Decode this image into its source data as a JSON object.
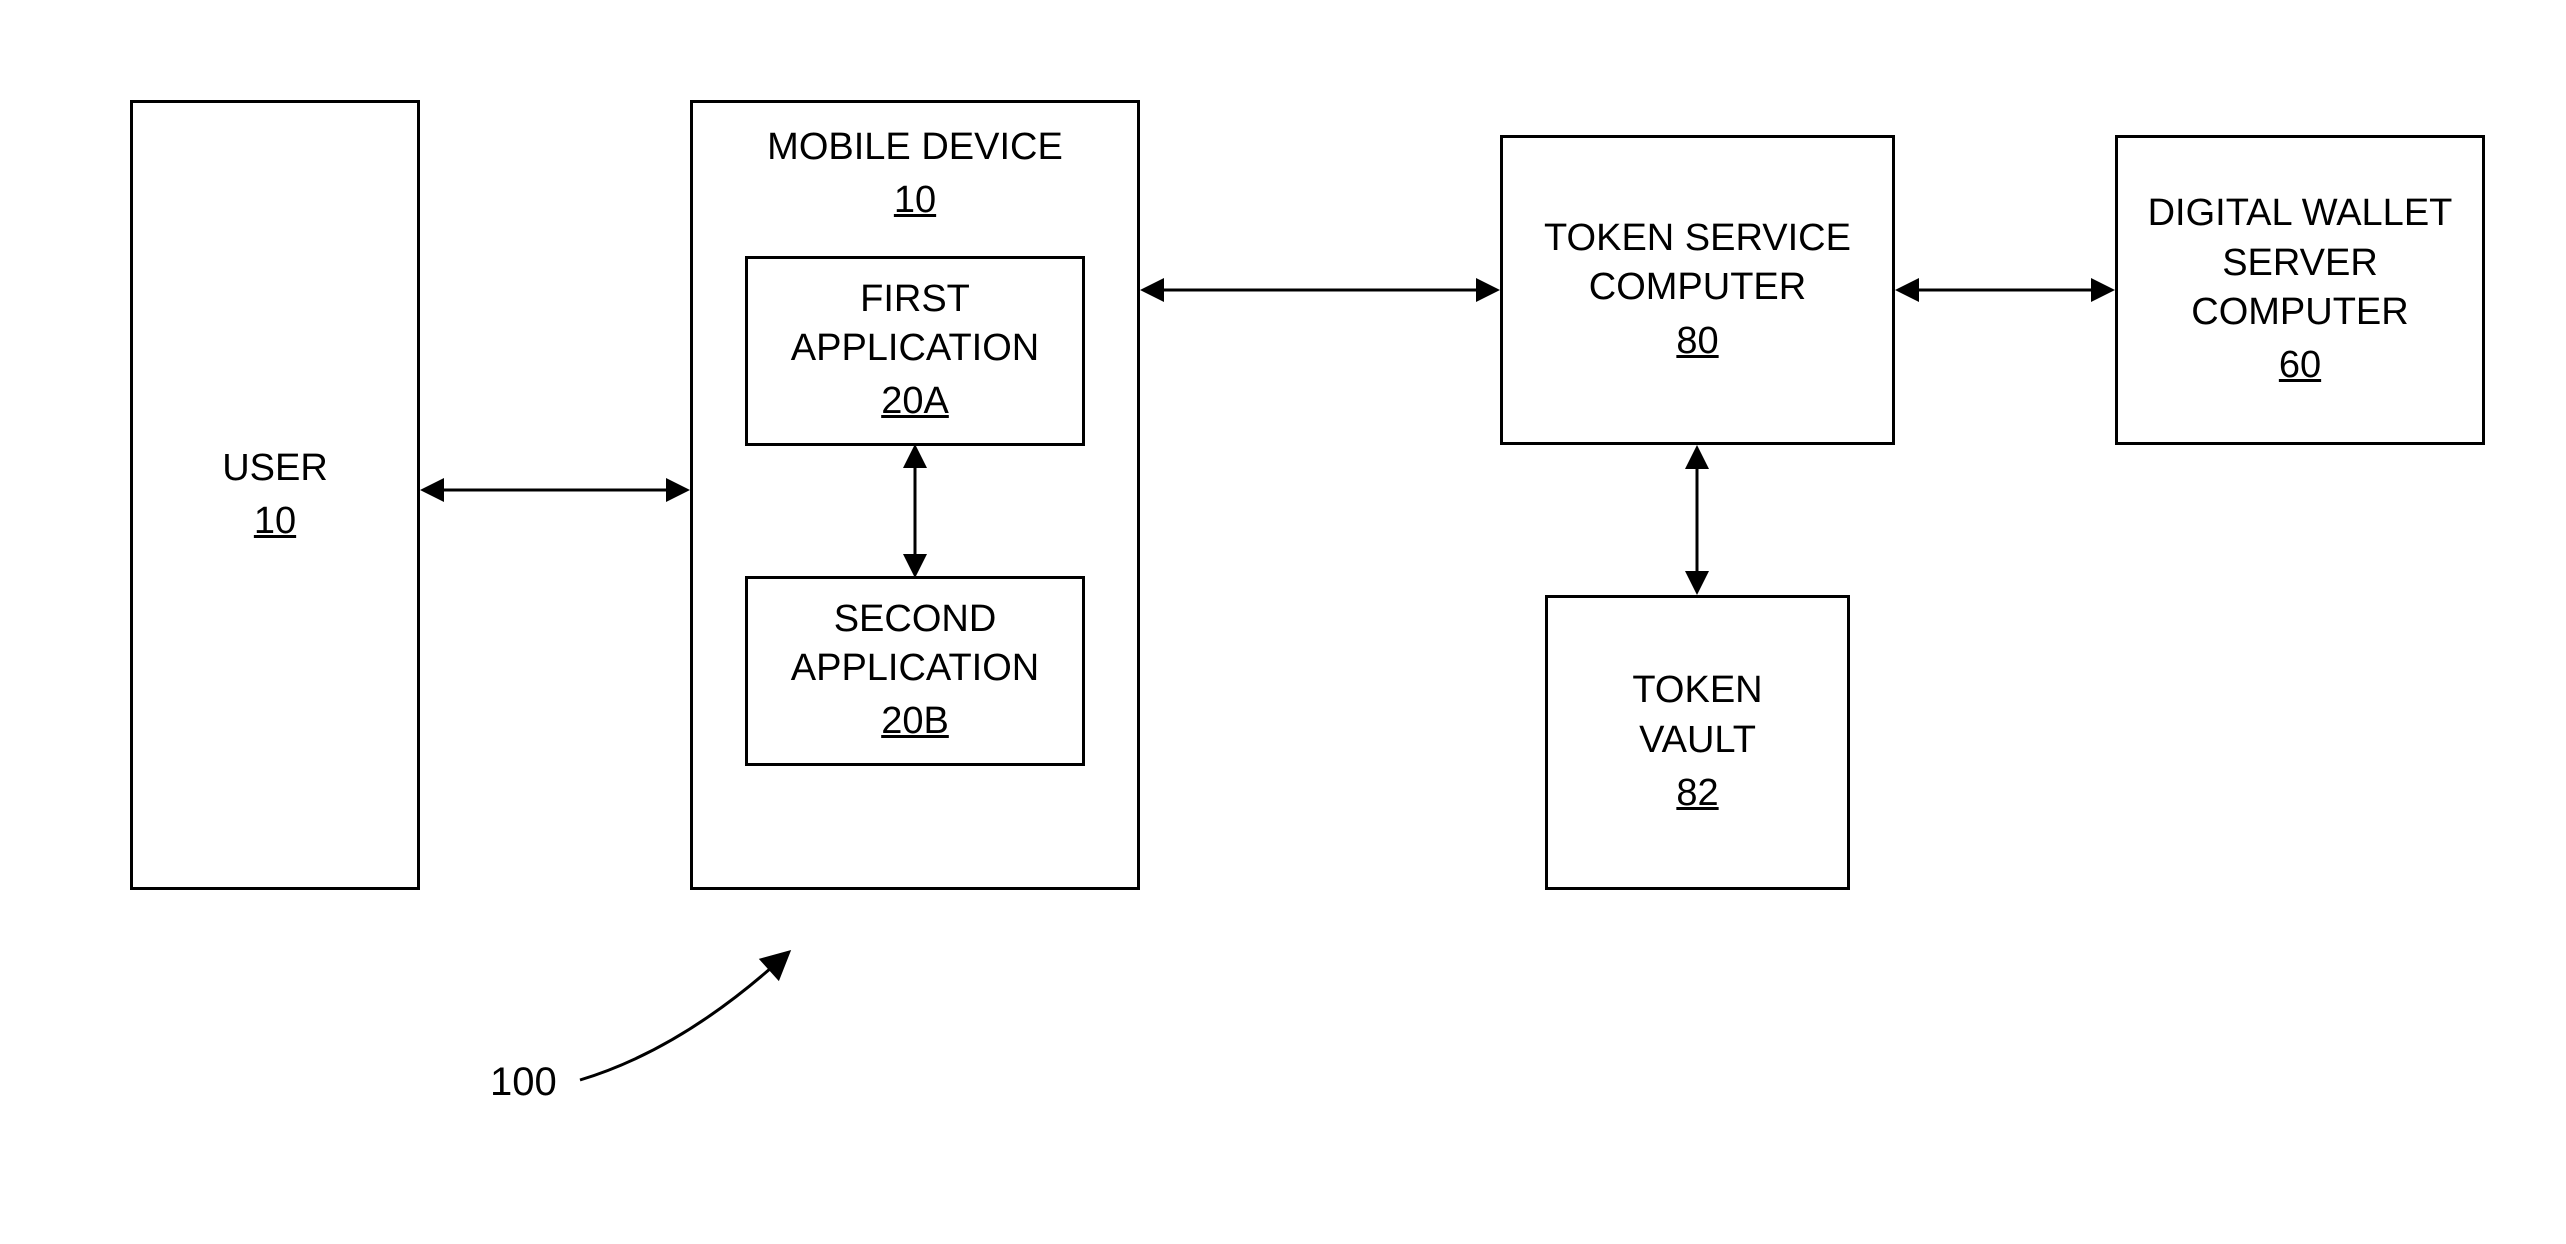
{
  "nodes": {
    "user": {
      "label": "USER",
      "ref": "10"
    },
    "mobile_device": {
      "label": "MOBILE DEVICE",
      "ref": "10"
    },
    "first_app": {
      "label1": "FIRST",
      "label2": "APPLICATION",
      "ref": "20A"
    },
    "second_app": {
      "label1": "SECOND",
      "label2": "APPLICATION",
      "ref": "20B"
    },
    "token_service": {
      "label1": "TOKEN SERVICE",
      "label2": "COMPUTER",
      "ref": "80"
    },
    "token_vault": {
      "label1": "TOKEN",
      "label2": "VAULT",
      "ref": "82"
    },
    "digital_wallet": {
      "label1": "DIGITAL WALLET",
      "label2": "SERVER",
      "label3": "COMPUTER",
      "ref": "60"
    }
  },
  "figure_ref": "100"
}
